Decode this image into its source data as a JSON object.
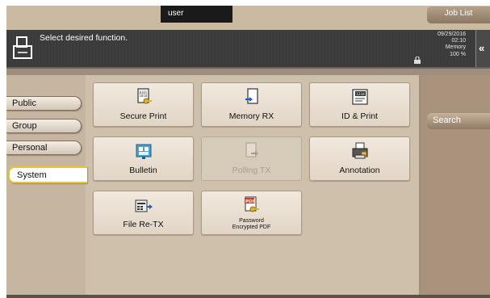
{
  "header": {
    "user": "user",
    "job_list": "Job List"
  },
  "message": {
    "text": "Select desired function."
  },
  "status": {
    "date": "09/29/2016",
    "time": "02:10",
    "memory_label": "Memory",
    "memory_value": "100 %"
  },
  "tabs": [
    {
      "label": "Public",
      "active": false
    },
    {
      "label": "Group",
      "active": false
    },
    {
      "label": "Personal",
      "active": false
    },
    {
      "label": "System",
      "active": true
    }
  ],
  "functions": [
    {
      "label": "Secure Print",
      "icon": "secure-print-icon",
      "enabled": true
    },
    {
      "label": "Memory RX",
      "icon": "memory-rx-icon",
      "enabled": true
    },
    {
      "label": "ID & Print",
      "icon": "id-print-icon",
      "enabled": true
    },
    {
      "label": "Bulletin",
      "icon": "bulletin-icon",
      "enabled": true
    },
    {
      "label": "Polling TX",
      "icon": "polling-tx-icon",
      "enabled": false
    },
    {
      "label": "Annotation",
      "icon": "annotation-icon",
      "enabled": true
    },
    {
      "label": "File Re-TX",
      "icon": "file-re-tx-icon",
      "enabled": true
    },
    {
      "label_line1": "Password",
      "label_line2": "Encrypted PDF",
      "icon": "password-pdf-icon",
      "enabled": true
    }
  ],
  "right_panel": {
    "search_label": "Search"
  },
  "colors": {
    "active_tab_border": "#e7c62a",
    "panel": "#cfc0ab",
    "message_bar": "#3b3b3b"
  }
}
